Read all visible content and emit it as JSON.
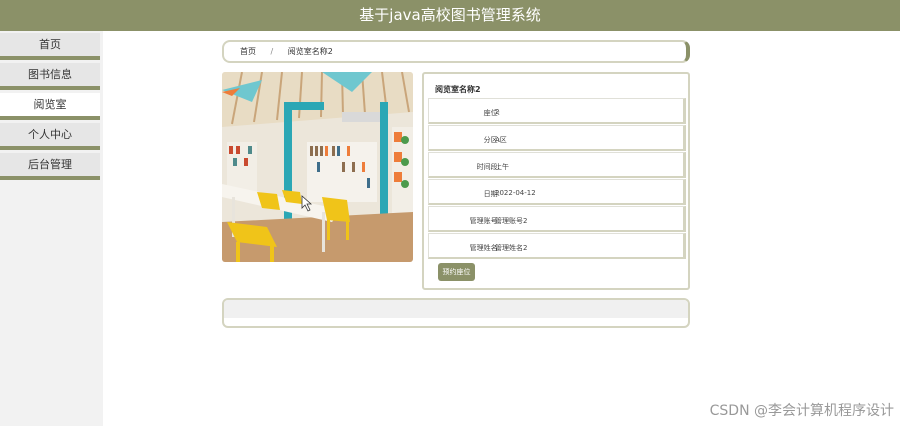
{
  "header": {
    "title": "基于java高校图书管理系统"
  },
  "sidebar": {
    "items": [
      {
        "label": "首页"
      },
      {
        "label": "图书信息"
      },
      {
        "label": "阅览室"
      },
      {
        "label": "个人中心"
      },
      {
        "label": "后台管理"
      }
    ],
    "active_index": 2
  },
  "breadcrumb": {
    "home": "首页",
    "separator": "/",
    "current": "阅览室名称2"
  },
  "detail": {
    "title": "阅览室名称2",
    "rows": [
      {
        "label": "座位:",
        "value": "2"
      },
      {
        "label": "分区:",
        "value": "A区"
      },
      {
        "label": "时间段:",
        "value": "上午"
      },
      {
        "label": "日期:",
        "value": "2022-04-12"
      },
      {
        "label": "管理账号:",
        "value": "管理账号2"
      },
      {
        "label": "管理姓名:",
        "value": "管理姓名2"
      }
    ],
    "reserve_label": "预约座位"
  },
  "watermark": "CSDN @李会计算机程序设计",
  "colors": {
    "accent": "#8b9168",
    "border": "#d4d4c0"
  },
  "image": {
    "subject": "library reading room photo"
  }
}
